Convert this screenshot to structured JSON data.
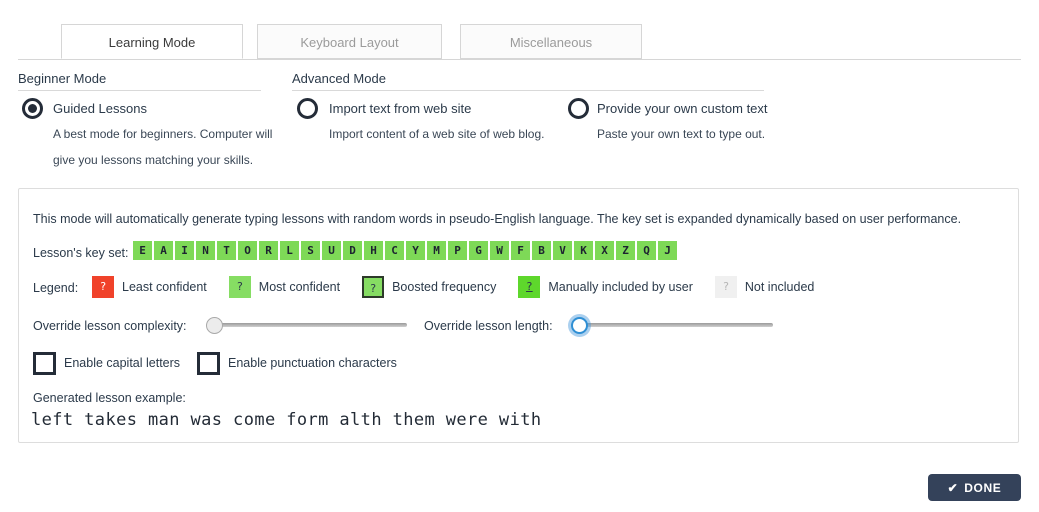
{
  "tabs": [
    {
      "label": "Learning Mode",
      "active": true
    },
    {
      "label": "Keyboard Layout",
      "active": false
    },
    {
      "label": "Miscellaneous",
      "active": false
    }
  ],
  "beginner": {
    "title": "Beginner Mode",
    "option": {
      "label": "Guided Lessons",
      "selected": true,
      "desc_line1": "A best mode for beginners. Computer will",
      "desc_line2": "give you lessons matching your skills."
    }
  },
  "advanced": {
    "title": "Advanced Mode",
    "options": [
      {
        "label": "Import text from web site",
        "selected": false,
        "desc": "Import content of a web site of web blog."
      },
      {
        "label": "Provide your own custom text",
        "selected": false,
        "desc": "Paste your own text to type out."
      }
    ]
  },
  "panel": {
    "description": "This mode will automatically generate typing lessons with random words in pseudo-English language. The key set is expanded dynamically based on user performance.",
    "keyset_label": "Lesson's key set:",
    "keys": [
      "E",
      "A",
      "I",
      "N",
      "T",
      "O",
      "R",
      "L",
      "S",
      "U",
      "D",
      "H",
      "C",
      "Y",
      "M",
      "P",
      "G",
      "W",
      "F",
      "B",
      "V",
      "K",
      "X",
      "Z",
      "Q",
      "J"
    ],
    "legend_label": "Legend:",
    "legend": [
      {
        "glyph": "?",
        "text": "Least confident",
        "color": "#f0422a"
      },
      {
        "glyph": "?",
        "text": "Most confident",
        "color": "#86dd63"
      },
      {
        "glyph": "?",
        "text": "Boosted frequency",
        "color": "#86dd63"
      },
      {
        "glyph": "?",
        "text": "Manually included by user",
        "color": "#5ed72c"
      },
      {
        "glyph": "?",
        "text": "Not included",
        "color": "#f0f0f0"
      }
    ],
    "slider_complexity_label": "Override lesson complexity:",
    "slider_complexity_value": 0,
    "slider_length_label": "Override lesson length:",
    "slider_length_value": 0,
    "checkbox_capitals": {
      "label": "Enable capital letters",
      "checked": false
    },
    "checkbox_punctuation": {
      "label": "Enable punctuation characters",
      "checked": false
    },
    "generated_label": "Generated lesson example:",
    "generated_text": "left takes man was come form alth them were with"
  },
  "footer": {
    "done_label": "DONE",
    "done_icon": "✔",
    "done_color": "#34425a"
  }
}
